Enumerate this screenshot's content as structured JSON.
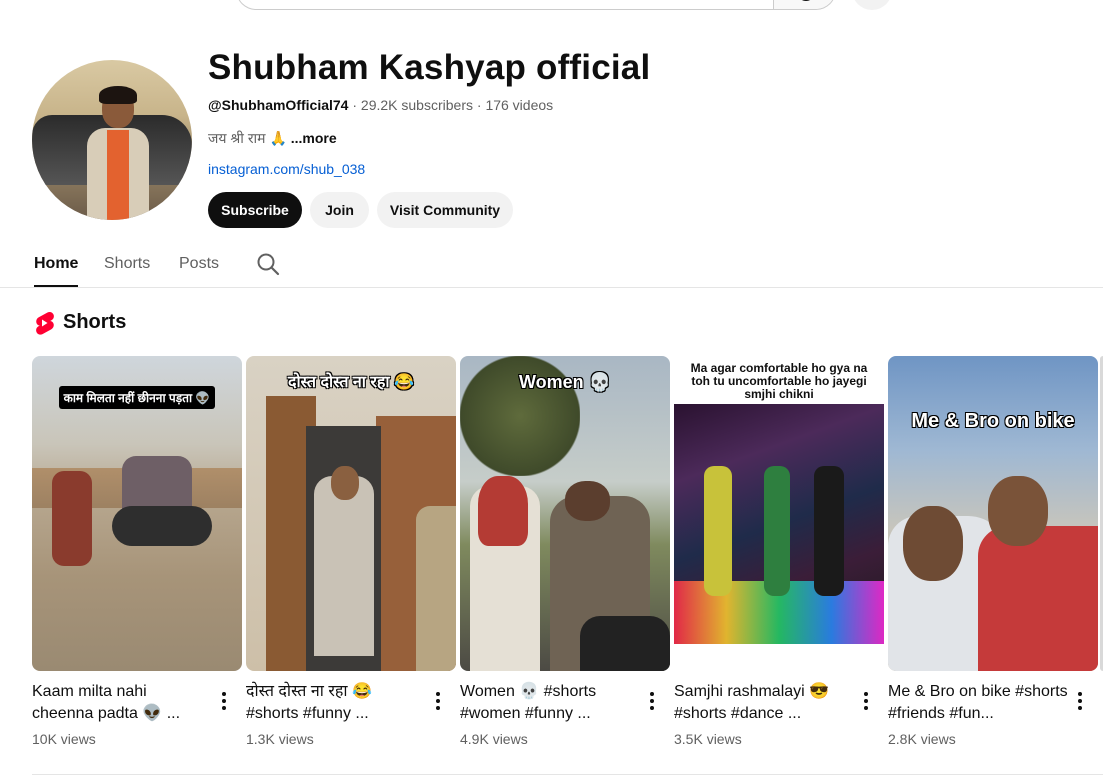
{
  "channel": {
    "name": "Shubham Kashyap official",
    "handle": "@ShubhamOfficial74",
    "subscribers": "29.2K subscribers",
    "videos": "176 videos",
    "description": "जय श्री राम 🙏",
    "more": "...more",
    "link": "instagram.com/shub_038"
  },
  "actions": {
    "subscribe": "Subscribe",
    "join": "Join",
    "community": "Visit Community"
  },
  "tabs": {
    "home": "Home",
    "shorts": "Shorts",
    "posts": "Posts"
  },
  "section": {
    "title": "Shorts"
  },
  "shorts": [
    {
      "caption": "काम मिलता नहीं छीनना पड़ता 👽",
      "title": "Kaam milta nahi cheenna padta 👽 ...",
      "views": "10K views"
    },
    {
      "caption": "दोस्त दोस्त ना रहा 😂",
      "title": "दोस्त दोस्त ना रहा 😂 #shorts #funny ...",
      "views": "1.3K views"
    },
    {
      "caption": "Women 💀",
      "title": "Women 💀 #shorts #women #funny ...",
      "views": "4.9K views"
    },
    {
      "caption": "Ma agar comfortable ho gya na toh tu uncomfortable ho jayegi smjhi chikni",
      "title": "Samjhi rashmalayi 😎 #shorts #dance ...",
      "views": "3.5K views"
    },
    {
      "caption": "Me & Bro on bike",
      "title": "Me & Bro on bike #shorts #friends #fun...",
      "views": "2.8K views"
    }
  ],
  "colors": {
    "accent": "#0f0f0f",
    "link": "#065fd4",
    "shorts_red": "#ff0033"
  }
}
